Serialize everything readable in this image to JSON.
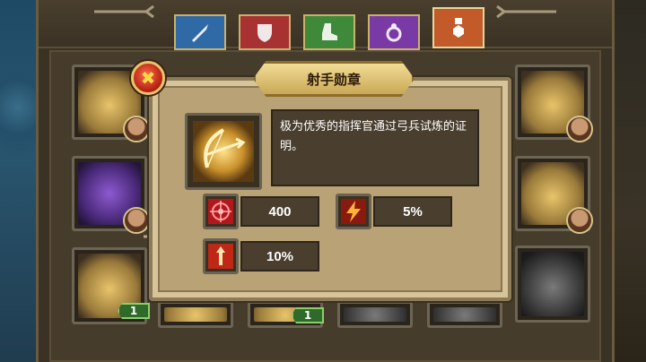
{
  "popup": {
    "title": "射手勋章",
    "description": "极为优秀的指挥官通过弓兵试炼的证明。",
    "stats": [
      {
        "icon": "crosshair-icon",
        "value": "400"
      },
      {
        "icon": "lightning-icon",
        "value": "5%"
      },
      {
        "icon": "arrow-boost-icon",
        "value": "10%"
      }
    ],
    "close_label": "✖"
  },
  "tabs": [
    "sword-icon",
    "shield-icon",
    "boot-icon",
    "ring-icon",
    "medal-icon"
  ],
  "slots": {
    "level_badges": [
      "1",
      "1"
    ]
  }
}
